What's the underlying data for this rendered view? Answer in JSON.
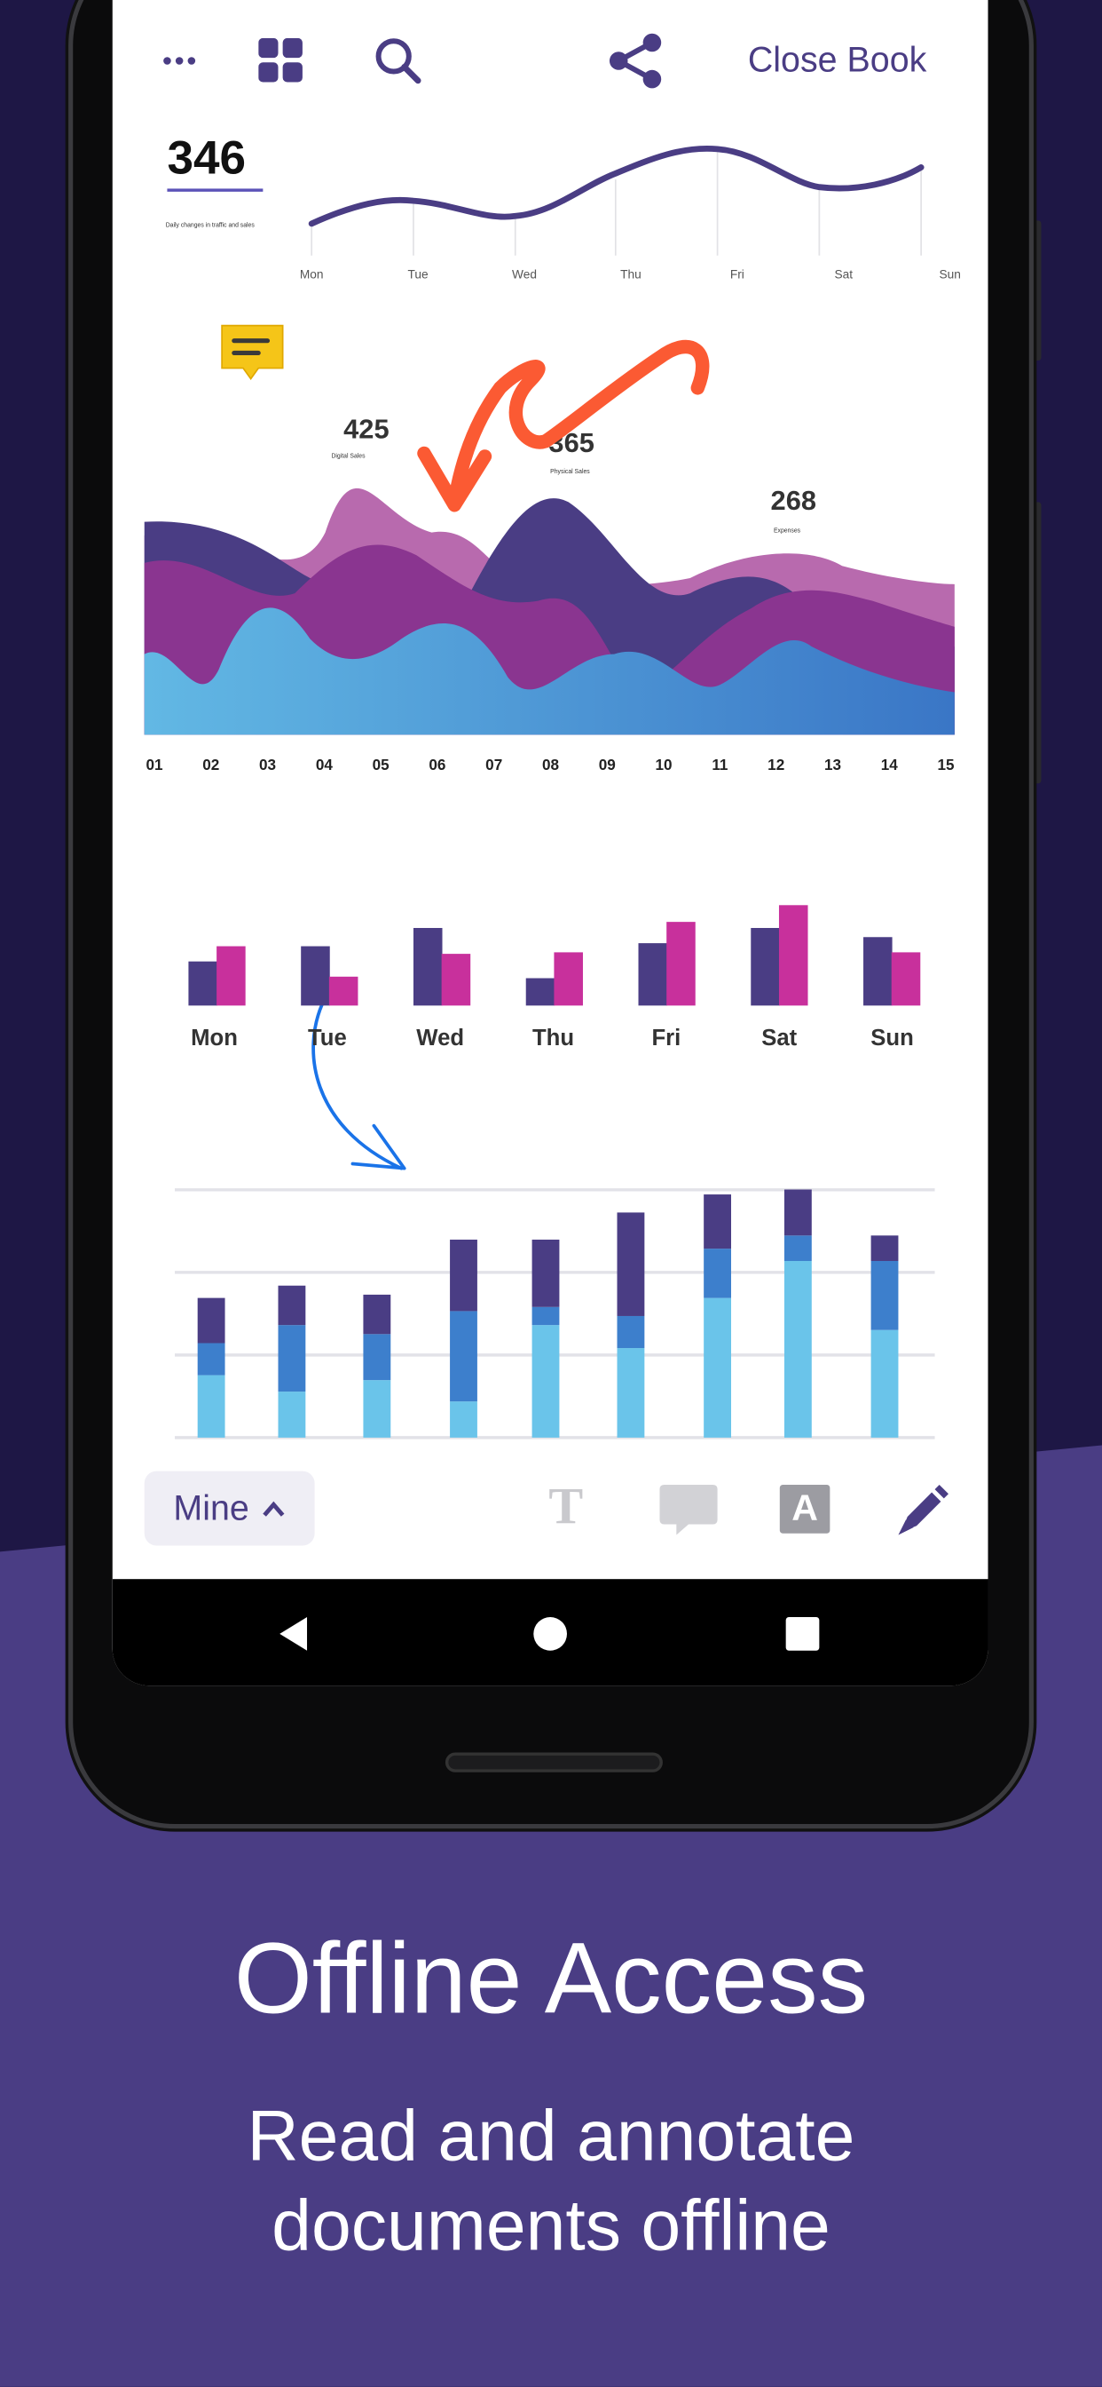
{
  "toolbar": {
    "close_book": "Close Book",
    "icons": [
      "more-icon",
      "grid-icon",
      "search-icon",
      "share-icon"
    ]
  },
  "line_card": {
    "value": "346",
    "caption": "Daily changes in traffic and sales",
    "days": [
      "Mon",
      "Tue",
      "Wed",
      "Thu",
      "Fri",
      "Sat",
      "Sun"
    ]
  },
  "area_card": {
    "stats": [
      {
        "value": "425",
        "label": "Digital Sales"
      },
      {
        "value": "365",
        "label": "Physical Sales"
      },
      {
        "value": "268",
        "label": "Expenses"
      }
    ],
    "x_labels": [
      "01",
      "02",
      "03",
      "04",
      "05",
      "06",
      "07",
      "08",
      "09",
      "10",
      "11",
      "12",
      "13",
      "14",
      "15"
    ]
  },
  "chart_data": [
    {
      "type": "bar",
      "categories": [
        "Mon",
        "Tue",
        "Wed",
        "Thu",
        "Fri",
        "Sat",
        "Sun"
      ],
      "series": [
        {
          "values": [
            29,
            39,
            51,
            18,
            41,
            51,
            45
          ]
        },
        {
          "values": [
            39,
            19,
            34,
            35,
            55,
            66,
            35
          ]
        }
      ],
      "colors": [
        "#4a3d84",
        "#c8309c"
      ]
    },
    {
      "type": "bar",
      "stacked": true,
      "gridlines": [
        0,
        1,
        2,
        3
      ],
      "series": [
        {
          "values": [
            0.76,
            0.56,
            0.7,
            0.44,
            1.37,
            1.09,
            1.7,
            2.15,
            1.31
          ]
        },
        {
          "values": [
            0.39,
            0.81,
            0.56,
            1.1,
            0.22,
            0.39,
            0.6,
            0.31,
            0.84
          ]
        },
        {
          "values": [
            0.55,
            0.48,
            0.48,
            0.87,
            0.82,
            1.26,
            0.66,
            0.56,
            0.31
          ]
        }
      ],
      "colors": [
        "#6ac4ea",
        "#3d7fcc",
        "#4a3d84"
      ]
    }
  ],
  "annotation_toolbar": {
    "author_filter": "Mine",
    "tools": [
      "text-tool-icon",
      "comment-tool-icon",
      "free-text-tool-icon",
      "pen-tool-icon"
    ],
    "free_text_glyph": "A",
    "text_glyph": "T"
  },
  "promo": {
    "title": "Offline Access",
    "subtitle_line1": "Read and annotate",
    "subtitle_line2": "documents offline"
  },
  "colors": {
    "brand": "#4a3d84",
    "background_dark": "#1e1745",
    "annotation_orange": "#fb5a33",
    "annotation_blue": "#1a73e8",
    "sticky_note": "#f5c518"
  }
}
